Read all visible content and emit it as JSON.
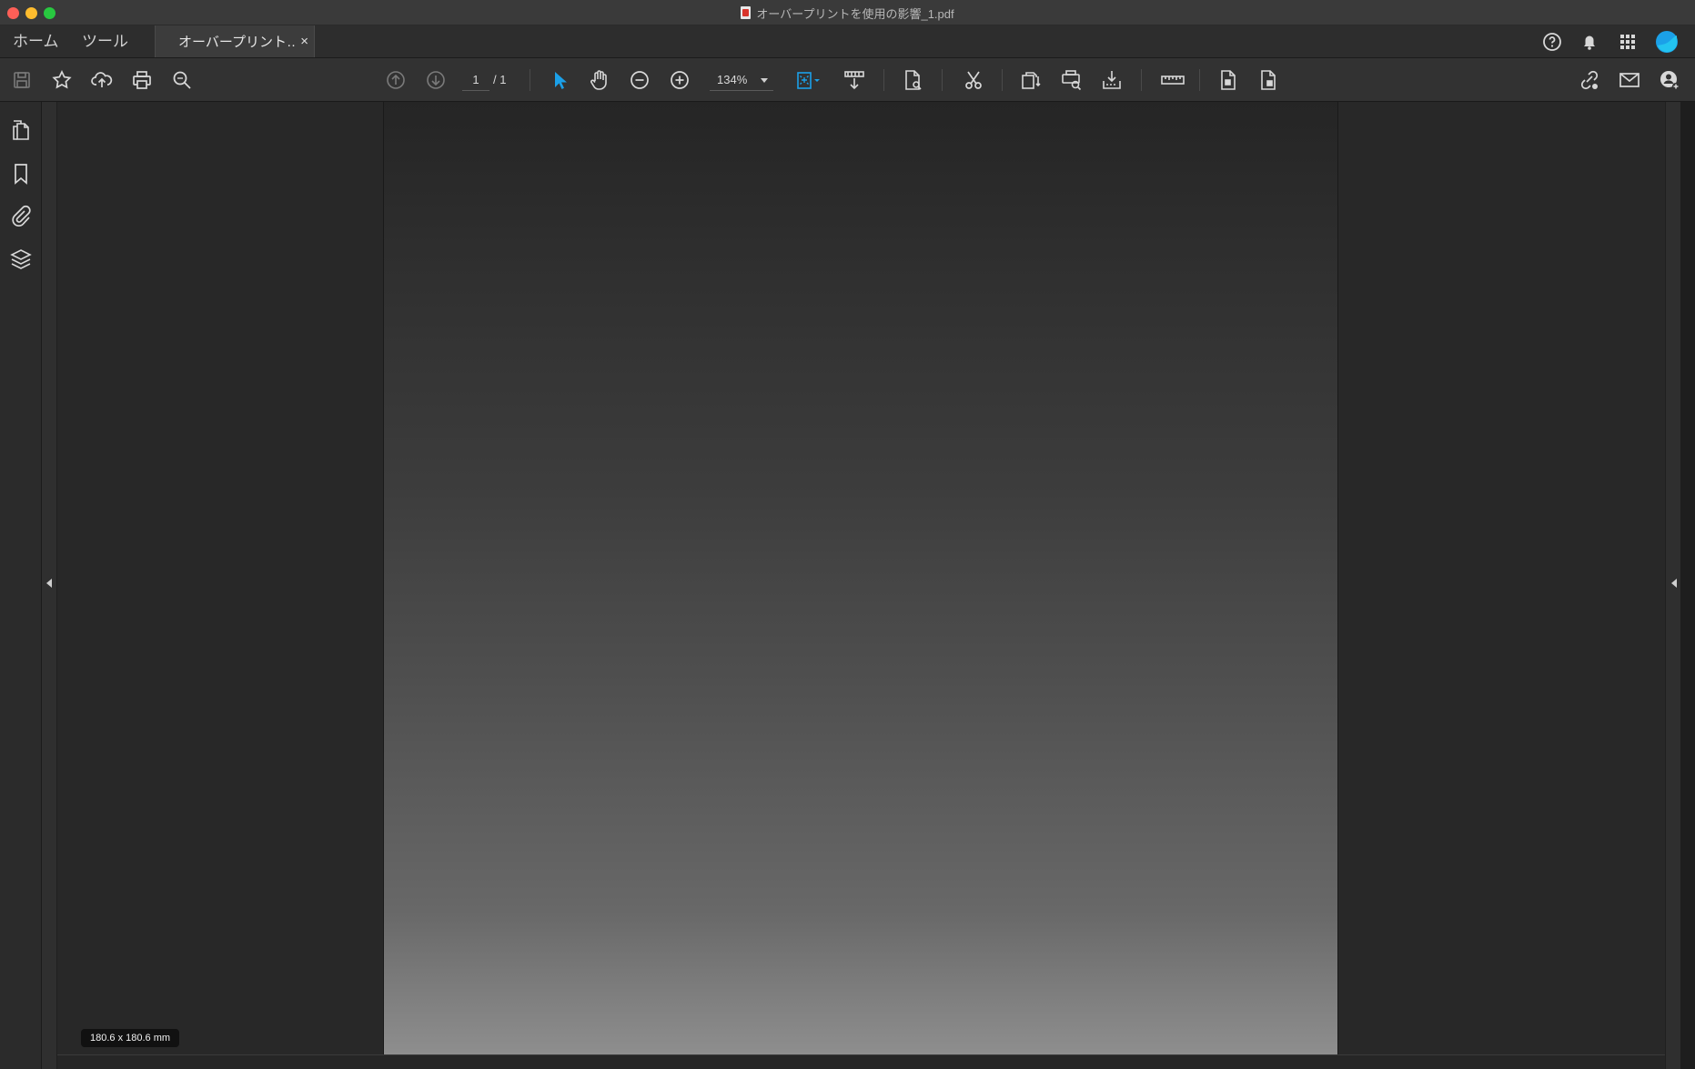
{
  "window": {
    "title": "オーバープリントを使用の影響_1.pdf"
  },
  "tabs": {
    "home_label": "ホーム",
    "tools_label": "ツール",
    "document_label": "オーバープリント…",
    "close_label": "×"
  },
  "toolbar": {
    "current_page": "1",
    "page_total": "/ 1",
    "zoom": "134%"
  },
  "status": {
    "page_dimensions": "180.6 x 180.6 mm"
  },
  "colors": {
    "accent": "#1ba0e8",
    "background": "#282828",
    "toolbar": "#323232"
  },
  "icons": {
    "top_right": [
      "help-icon",
      "bell-icon",
      "apps-grid-icon",
      "account-avatar-icon"
    ],
    "left_rail": [
      "pages-icon",
      "bookmark-icon",
      "attachment-icon",
      "layers-icon"
    ]
  }
}
